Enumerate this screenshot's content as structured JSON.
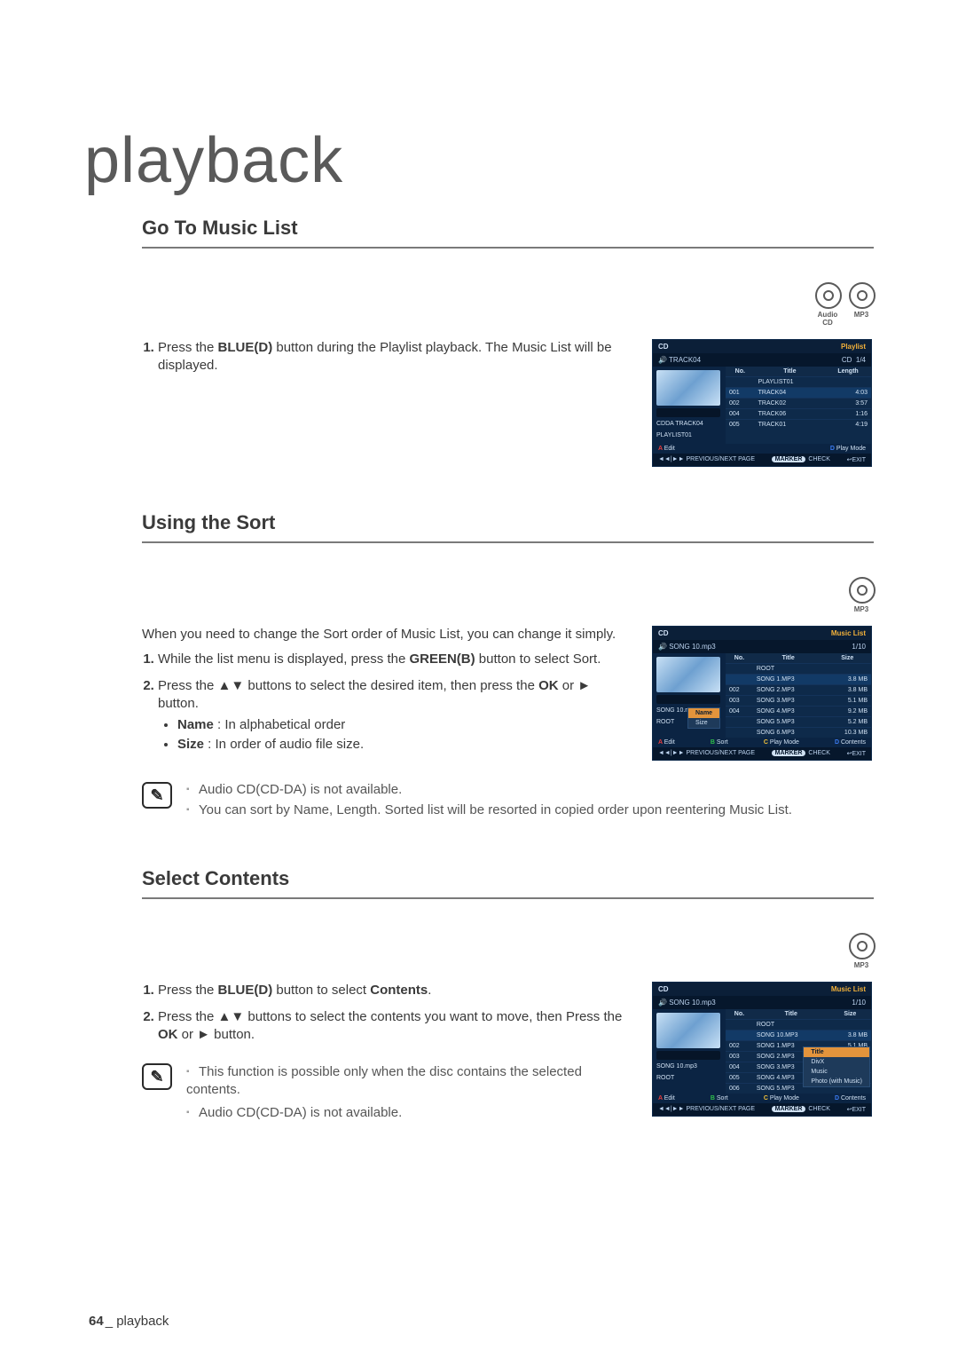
{
  "chapter_title": "playback",
  "page_footer": {
    "num": "64",
    "label": "playback"
  },
  "discs": {
    "audio_cd": "Audio CD",
    "mp3": "MP3"
  },
  "section1": {
    "heading": "Go To Music List",
    "steps": [
      {
        "pre": "Press the ",
        "b": "BLUE(D)",
        "post": " button during the Playlist playback. The Music List will be displayed."
      }
    ],
    "ui": {
      "top_left": "CD",
      "top_right": "Playlist",
      "sub_left": "TRACK04",
      "sub_right_pre": "CD",
      "sub_right": "1/4",
      "headers": {
        "no": "No.",
        "title": "Title",
        "length": "Length"
      },
      "left_info1": "CDDA  TRACK04",
      "left_info2": "PLAYLIST01",
      "rows": [
        {
          "no": "",
          "title": "PLAYLIST01",
          "len": ""
        },
        {
          "no": "001",
          "title": "TRACK04",
          "len": "4:03",
          "sel": true
        },
        {
          "no": "002",
          "title": "TRACK02",
          "len": "3:57"
        },
        {
          "no": "004",
          "title": "TRACK06",
          "len": "1:16"
        },
        {
          "no": "005",
          "title": "TRACK01",
          "len": "4:19"
        }
      ],
      "foot_a": "Edit",
      "foot_d": "Play Mode",
      "foot2_left": "PREVIOUS/NEXT PAGE",
      "foot2_mid_pill": "MARKER",
      "foot2_mid": "CHECK",
      "foot2_right": "EXIT"
    }
  },
  "section2": {
    "heading": "Using the Sort",
    "intro": "When you need to change the Sort order of Music List, you can change it simply.",
    "steps": [
      {
        "pre": "While the list menu is displayed, press the ",
        "b": "GREEN(B)",
        "post": " button to select Sort."
      },
      {
        "pre": "Press the ▲▼ buttons to select the desired item, then press the ",
        "b": "OK",
        "post": " or ► button."
      }
    ],
    "bullets": [
      {
        "b": "Name",
        "post": " : In alphabetical order"
      },
      {
        "b": "Size",
        "post": " : In order of audio file size."
      }
    ],
    "notes": [
      "Audio CD(CD-DA) is not available.",
      "You can sort by Name, Length. Sorted list will be resorted in copied order upon reentering Music List."
    ],
    "ui": {
      "top_left": "CD",
      "top_right": "Music List",
      "sub_left": "SONG 10.mp3",
      "sub_right": "1/10",
      "headers": {
        "no": "No.",
        "title": "Title",
        "size": "Size"
      },
      "left_info1": "SONG 10.mp3",
      "left_info2": "ROOT",
      "rows": [
        {
          "no": "",
          "title": "ROOT",
          "size": ""
        },
        {
          "no": "",
          "title": "SONG 1.MP3",
          "size": "3.8 MB",
          "sel": true
        },
        {
          "no": "002",
          "title": "SONG 2.MP3",
          "size": "3.8 MB"
        },
        {
          "no": "003",
          "title": "SONG 3.MP3",
          "size": "5.1 MB"
        },
        {
          "no": "004",
          "title": "SONG 4.MP3",
          "size": "9.2 MB"
        },
        {
          "no": "",
          "title": "SONG 5.MP3",
          "size": "5.2 MB"
        },
        {
          "no": "",
          "title": "SONG 6.MP3",
          "size": "10.3 MB"
        }
      ],
      "popup": [
        {
          "label": "Name",
          "sel": true
        },
        {
          "label": "Size"
        }
      ],
      "foot_a": "Edit",
      "foot_b": "Sort",
      "foot_c": "Play Mode",
      "foot_d": "Contents",
      "foot2_left": "PREVIOUS/NEXT PAGE",
      "foot2_mid_pill": "MARKER",
      "foot2_mid": "CHECK",
      "foot2_right": "EXIT"
    }
  },
  "section3": {
    "heading": "Select Contents",
    "steps": [
      {
        "pre": "Press the ",
        "b": "BLUE(D)",
        "mid": " button to select ",
        "b2": "Contents",
        "post": "."
      },
      {
        "pre": "Press the ▲▼ buttons to select the contents you want to move, then Press the ",
        "b": "OK",
        "post": " or ► button."
      }
    ],
    "notes": [
      "This function is possible only when the disc contains the selected contents.",
      "Audio CD(CD-DA) is not available."
    ],
    "ui": {
      "top_left": "CD",
      "top_right": "Music List",
      "sub_left": "SONG 10.mp3",
      "sub_right": "1/10",
      "headers": {
        "no": "No.",
        "title": "Title",
        "size": "Size"
      },
      "left_info1": "SONG 10.mp3",
      "left_info2": "ROOT",
      "rows": [
        {
          "no": "",
          "title": "ROOT",
          "size": ""
        },
        {
          "no": "",
          "title": "SONG 10.MP3",
          "size": "3.8 MB",
          "sel": true
        },
        {
          "no": "002",
          "title": "SONG 1.MP3",
          "size": "5.1 MB"
        },
        {
          "no": "003",
          "title": "SONG 2.MP3",
          "size": ""
        },
        {
          "no": "004",
          "title": "SONG 3.MP3",
          "size": ""
        },
        {
          "no": "005",
          "title": "SONG 4.MP3",
          "size": ""
        },
        {
          "no": "006",
          "title": "SONG 5.MP3",
          "size": ""
        }
      ],
      "popup": [
        {
          "label": "Title",
          "sel": true
        },
        {
          "label": "DivX"
        },
        {
          "label": "Music"
        },
        {
          "label": "Photo (with Music)"
        }
      ],
      "foot_a": "Edit",
      "foot_b": "Sort",
      "foot_c": "Play Mode",
      "foot_d": "Contents",
      "foot2_left": "PREVIOUS/NEXT PAGE",
      "foot2_mid_pill": "MARKER",
      "foot2_mid": "CHECK",
      "foot2_right": "EXIT"
    }
  }
}
